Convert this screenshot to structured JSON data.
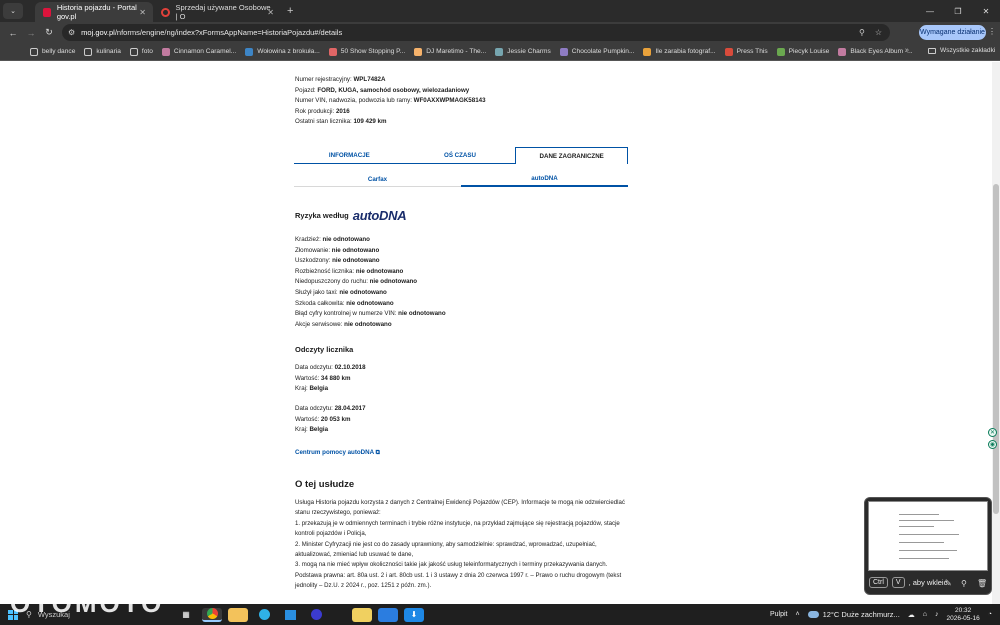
{
  "browser": {
    "tabs": [
      {
        "title": "Historia pojazdu - Portal gov.pl",
        "active": true
      },
      {
        "title": "Sprzedaj używane Osobowe | O",
        "active": false
      }
    ],
    "url_host": "moj.gov.pl",
    "url_path": "/nforms/engine/ng/index?xFormsAppName=HistoriaPojazdu#/details",
    "update_button": "Wymagane działanie",
    "bookmarks": [
      {
        "label": "belly dance",
        "icon": "folder-icon"
      },
      {
        "label": "kulinaria",
        "icon": "folder-icon"
      },
      {
        "label": "foto",
        "icon": "folder-icon"
      },
      {
        "label": "Cinnamon Caramel...",
        "icon": "site-icon"
      },
      {
        "label": "Wołowina z brokuła...",
        "icon": "site-icon"
      },
      {
        "label": "50 Show Stopping P...",
        "icon": "site-icon"
      },
      {
        "label": "DJ Maretimo - The...",
        "icon": "site-icon"
      },
      {
        "label": "Jessie Charms",
        "icon": "site-icon"
      },
      {
        "label": "Chocolate Pumpkin...",
        "icon": "site-icon"
      },
      {
        "label": "Ile zarabia fotograf...",
        "icon": "site-icon"
      },
      {
        "label": "Press This",
        "icon": "site-icon"
      },
      {
        "label": "Piecyk Louise",
        "icon": "site-icon"
      },
      {
        "label": "Black Eyes Album -...",
        "icon": "site-icon"
      }
    ],
    "bookmarks_more": "»",
    "all_bookmarks": "Wszystkie zakładki"
  },
  "vehicle": {
    "lines": [
      {
        "label": "Numer rejestracyjny: ",
        "value": "WPL7482A"
      },
      {
        "label": "Pojazd: ",
        "value": "FORD, KUGA, samochód osobowy, wielozadaniowy"
      },
      {
        "label": "Numer VIN, nadwozia, podwozia lub ramy: ",
        "value": "WF0AXXWPMAGK58143"
      },
      {
        "label": "Rok produkcji: ",
        "value": "2016"
      },
      {
        "label": "Ostatni stan licznika: ",
        "value": "109 429 km"
      }
    ]
  },
  "tabs_main": [
    "INFORMACJE",
    "OŚ CZASU",
    "DANE ZAGRANICZNE"
  ],
  "tabs_sub": [
    "Carfax",
    "autoDNA"
  ],
  "risks": {
    "heading": "Ryzyka według",
    "brand": "autoDNA",
    "items": [
      {
        "label": "Kradzież: ",
        "value": "nie odnotowano"
      },
      {
        "label": "Złomowanie: ",
        "value": "nie odnotowano"
      },
      {
        "label": "Uszkodzony: ",
        "value": "nie odnotowano"
      },
      {
        "label": "Rozbieżność licznika: ",
        "value": "nie odnotowano"
      },
      {
        "label": "Niedopuszczony do ruchu: ",
        "value": "nie odnotowano"
      },
      {
        "label": "Służył jako taxi: ",
        "value": "nie odnotowano"
      },
      {
        "label": "Szkoda całkowita: ",
        "value": "nie odnotowano"
      },
      {
        "label": "Błąd cyfry kontrolnej w numerze VIN: ",
        "value": "nie odnotowano"
      },
      {
        "label": "Akcje serwisowe: ",
        "value": "nie odnotowano"
      }
    ]
  },
  "odometer": {
    "heading": "Odczyty licznika",
    "readings": [
      {
        "date_label": "Data odczytu: ",
        "date": "02.10.2018",
        "value_label": "Wartość: ",
        "value": "34 880 km",
        "country_label": "Kraj: ",
        "country": "Belgia"
      },
      {
        "date_label": "Data odczytu: ",
        "date": "28.04.2017",
        "value_label": "Wartość: ",
        "value": "20 053 km",
        "country_label": "Kraj: ",
        "country": "Belgia"
      }
    ]
  },
  "help_link": "Centrum pomocy autoDNA",
  "about": {
    "heading": "O tej usłudze",
    "intro": "Usługa Historia pojazdu korzysta z danych z Centralnej Ewidencji Pojazdów (CEP). Informacje te mogą nie odzwierciedlać stanu rzeczywistego, ponieważ:",
    "points": [
      "1. przekazują je w odmiennych terminach i trybie różne instytucje, na przykład zajmujące się rejestracją pojazdów, stacje kontroli pojazdów i Policja,",
      "2. Minister Cyfryzacji nie jest co do zasady uprawniony, aby samodzielnie: sprawdzać, wprowadzać, uzupełniać, aktualizować, zmieniać lub usuwać te dane,",
      "3. mogą na nie mieć wpływ okoliczności takie jak jakość usług teleinformatycznych i terminy przekazywania danych."
    ],
    "legal": "Podstawa prawna: art. 80a ust. 2 i art. 80cb ust. 1 i 3 ustawy z dnia 20 czerwca 1997 r. – Prawo o ruchu drogowym (tekst jednolity – Dz.U. z 2024 r., poz. 1251 z późn. zm.)."
  },
  "clipboard": {
    "key1": "Ctrl",
    "key2": "V",
    "text": ", aby wkleić"
  },
  "watermark": "OTOMOTO",
  "taskbar": {
    "search": "Wyszukaj",
    "desktop": "Pulpit",
    "weather": "12°C  Duże zachmurz...",
    "time": "20:32",
    "date": "2026-05-16"
  },
  "colors": {
    "link": "#0052a5",
    "brand": "#1a2d6b",
    "update": "#a8c7fa"
  }
}
